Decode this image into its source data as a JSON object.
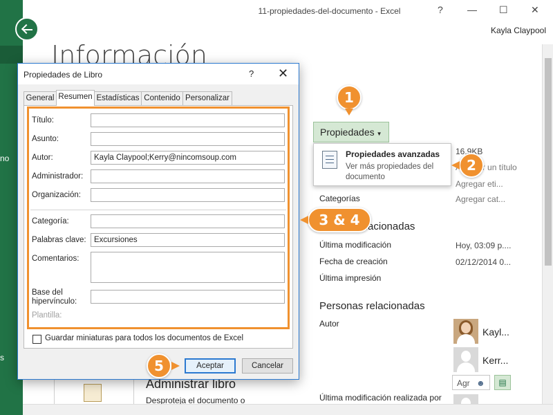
{
  "window": {
    "title": "11-propiedades-del-documento  -  Excel",
    "controls": {
      "help": "?",
      "minimize": "—",
      "maximize": "☐",
      "close": "✕"
    },
    "user": "Kayla Claypool"
  },
  "rail": {
    "back_icon": "back-arrow-icon",
    "visible_text_1": "no",
    "visible_text_2": "s"
  },
  "backstage": {
    "heading": "Información",
    "properties_button": "Propiedades",
    "dropdown": {
      "title": "Propiedades avanzadas",
      "description": "Ver más propiedades del documento"
    },
    "info_rows": [
      {
        "value": "16,9KB"
      },
      {
        "value": "Agregar un título"
      },
      {
        "value": "Agregar eti..."
      },
      {
        "label": "Categorías",
        "value": "Agregar cat..."
      }
    ],
    "related_dates": {
      "heading": "Fechas relacionadas",
      "rows": [
        {
          "label": "Última modificación",
          "value": "Hoy, 03:09 p...."
        },
        {
          "label": "Fecha de creación",
          "value": "02/12/2014 0..."
        },
        {
          "label": "Última impresión",
          "value": ""
        }
      ]
    },
    "related_people": {
      "heading": "Personas relacionadas",
      "author_label": "Autor",
      "people": [
        {
          "name": "Kayl..."
        },
        {
          "name": "Kerr..."
        }
      ],
      "add_author": "Agr",
      "last_modified_by": "Última modificación realizada por"
    },
    "manage": {
      "heading": "Administrar libro",
      "subtitle": "Desproteja el documento o"
    }
  },
  "dialog": {
    "title": "Propiedades de Libro",
    "help": "?",
    "close": "✕",
    "tabs": [
      "General",
      "Resumen",
      "Estadísticas",
      "Contenido",
      "Personalizar"
    ],
    "active_tab": "Resumen",
    "fields": {
      "titulo": {
        "label": "Título:",
        "value": ""
      },
      "asunto": {
        "label": "Asunto:",
        "value": ""
      },
      "autor": {
        "label": "Autor:",
        "value": "Kayla Claypool;Kerry@nincomsoup.com"
      },
      "administrador": {
        "label": "Administrador:",
        "value": ""
      },
      "organizacion": {
        "label": "Organización:",
        "value": ""
      },
      "categoria": {
        "label": "Categoría:",
        "value": ""
      },
      "palabras": {
        "label": "Palabras clave:",
        "value": "Excursiones"
      },
      "comentarios": {
        "label": "Comentarios:",
        "value": ""
      },
      "base_line1": "Base del",
      "base_line2": "hipervínculo:",
      "base_value": "",
      "plantilla": "Plantilla:"
    },
    "checkbox_label": "Guardar miniaturas para todos los documentos de Excel",
    "checkbox_checked": false,
    "accept": "Aceptar",
    "cancel": "Cancelar"
  },
  "callouts": {
    "c1": "1",
    "c2": "2",
    "c34": "3 & 4",
    "c5": "5",
    "color": "#f0912f"
  },
  "colors": {
    "excel_green": "#217346",
    "accent_blue": "#2b79d0"
  }
}
